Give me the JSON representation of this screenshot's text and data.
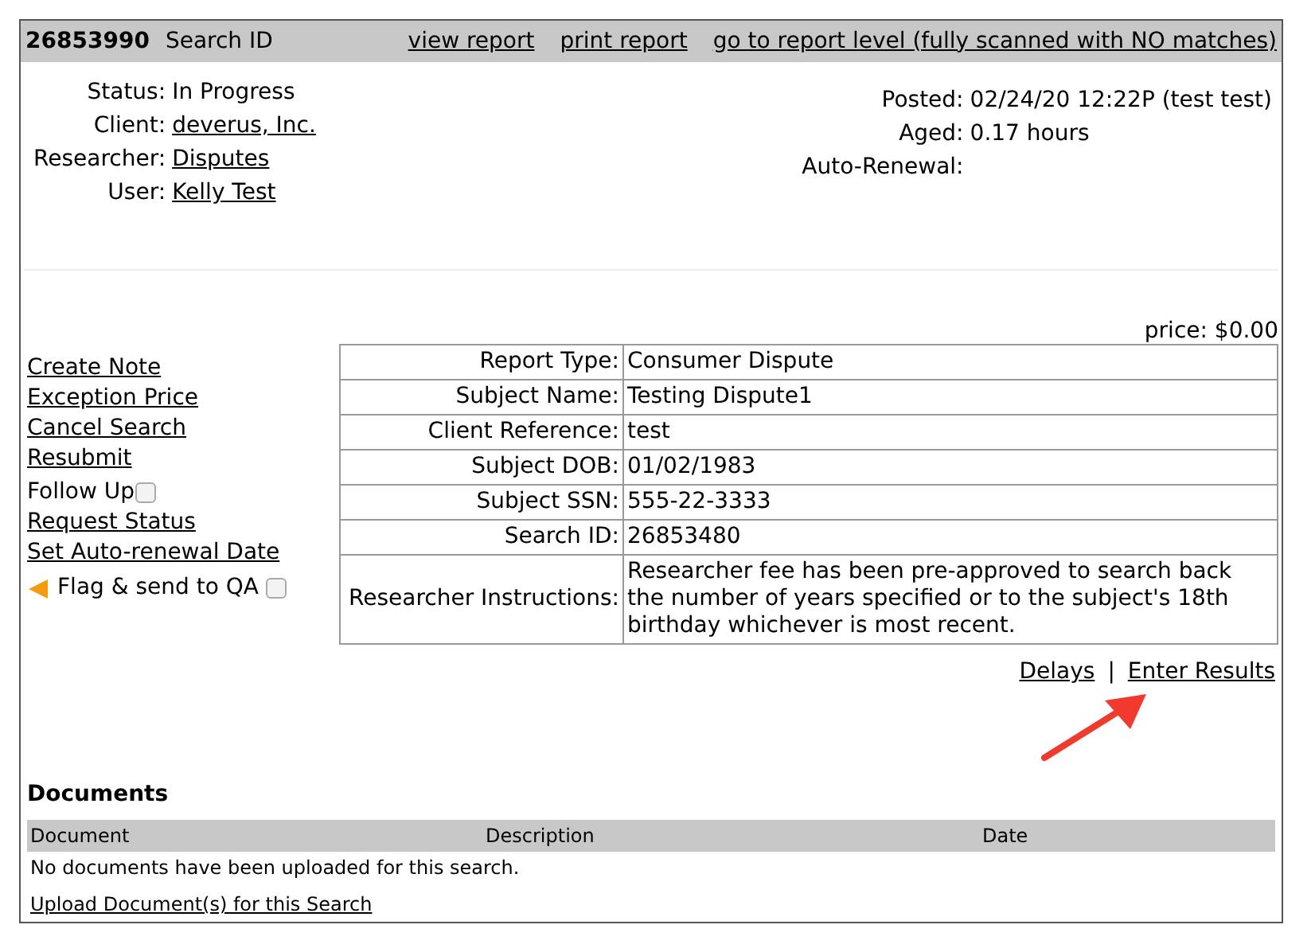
{
  "header": {
    "search_number": "26853990",
    "label": "Search ID",
    "links": [
      "view report",
      "print report",
      "go to report level (fully scanned with NO matches)"
    ]
  },
  "info_left": [
    {
      "label": "Status:",
      "value": "In Progress",
      "kind": "text"
    },
    {
      "label": "Client:",
      "value": "deverus, Inc.",
      "kind": "link"
    },
    {
      "label": "Researcher:",
      "value": "Disputes",
      "kind": "link"
    },
    {
      "label": "User:",
      "value": "Kelly Test",
      "kind": "link"
    }
  ],
  "info_right": [
    {
      "label": "Posted:",
      "value": "02/24/20 12:22P (test test)"
    },
    {
      "label": "Aged:",
      "value": "0.17 hours"
    },
    {
      "label": "Auto-Renewal:"
    }
  ],
  "price": "price: $0.00",
  "actions": [
    {
      "kind": "link",
      "label": "Create Note"
    },
    {
      "kind": "link",
      "label": "Exception Price"
    },
    {
      "kind": "link",
      "label": "Cancel Search"
    },
    {
      "kind": "link",
      "label": "Resubmit"
    },
    {
      "kind": "checkbox",
      "label": "Follow Up",
      "checked": false
    },
    {
      "kind": "link",
      "label": "Request Status"
    },
    {
      "kind": "link",
      "label": "Set Auto-renewal Date"
    },
    {
      "kind": "flag",
      "label": "Flag & send to QA",
      "checked": false
    }
  ],
  "details": [
    {
      "label": "Report Type:",
      "value": "Consumer Dispute"
    },
    {
      "label": "Subject Name:",
      "value": "Testing Dispute1"
    },
    {
      "label": "Client Reference:",
      "value": "test"
    },
    {
      "label": "Subject DOB:",
      "value": "01/02/1983"
    },
    {
      "label": "Subject SSN:",
      "value": "555-22-3333"
    },
    {
      "label": "Search ID:",
      "value": "26853480"
    },
    {
      "label": "Researcher Instructions:",
      "value": "Researcher fee has been pre-approved to search back the number of years specified or to the subject's 18th birthday whichever is most recent."
    }
  ],
  "result_links": [
    "Delays",
    "|",
    "Enter Results"
  ],
  "documents": {
    "title": "Documents",
    "columns": [
      "Document",
      "Description",
      "Date"
    ],
    "empty_message": "No documents have been uploaded for this search.",
    "upload_link": "Upload Document(s) for this Search"
  }
}
